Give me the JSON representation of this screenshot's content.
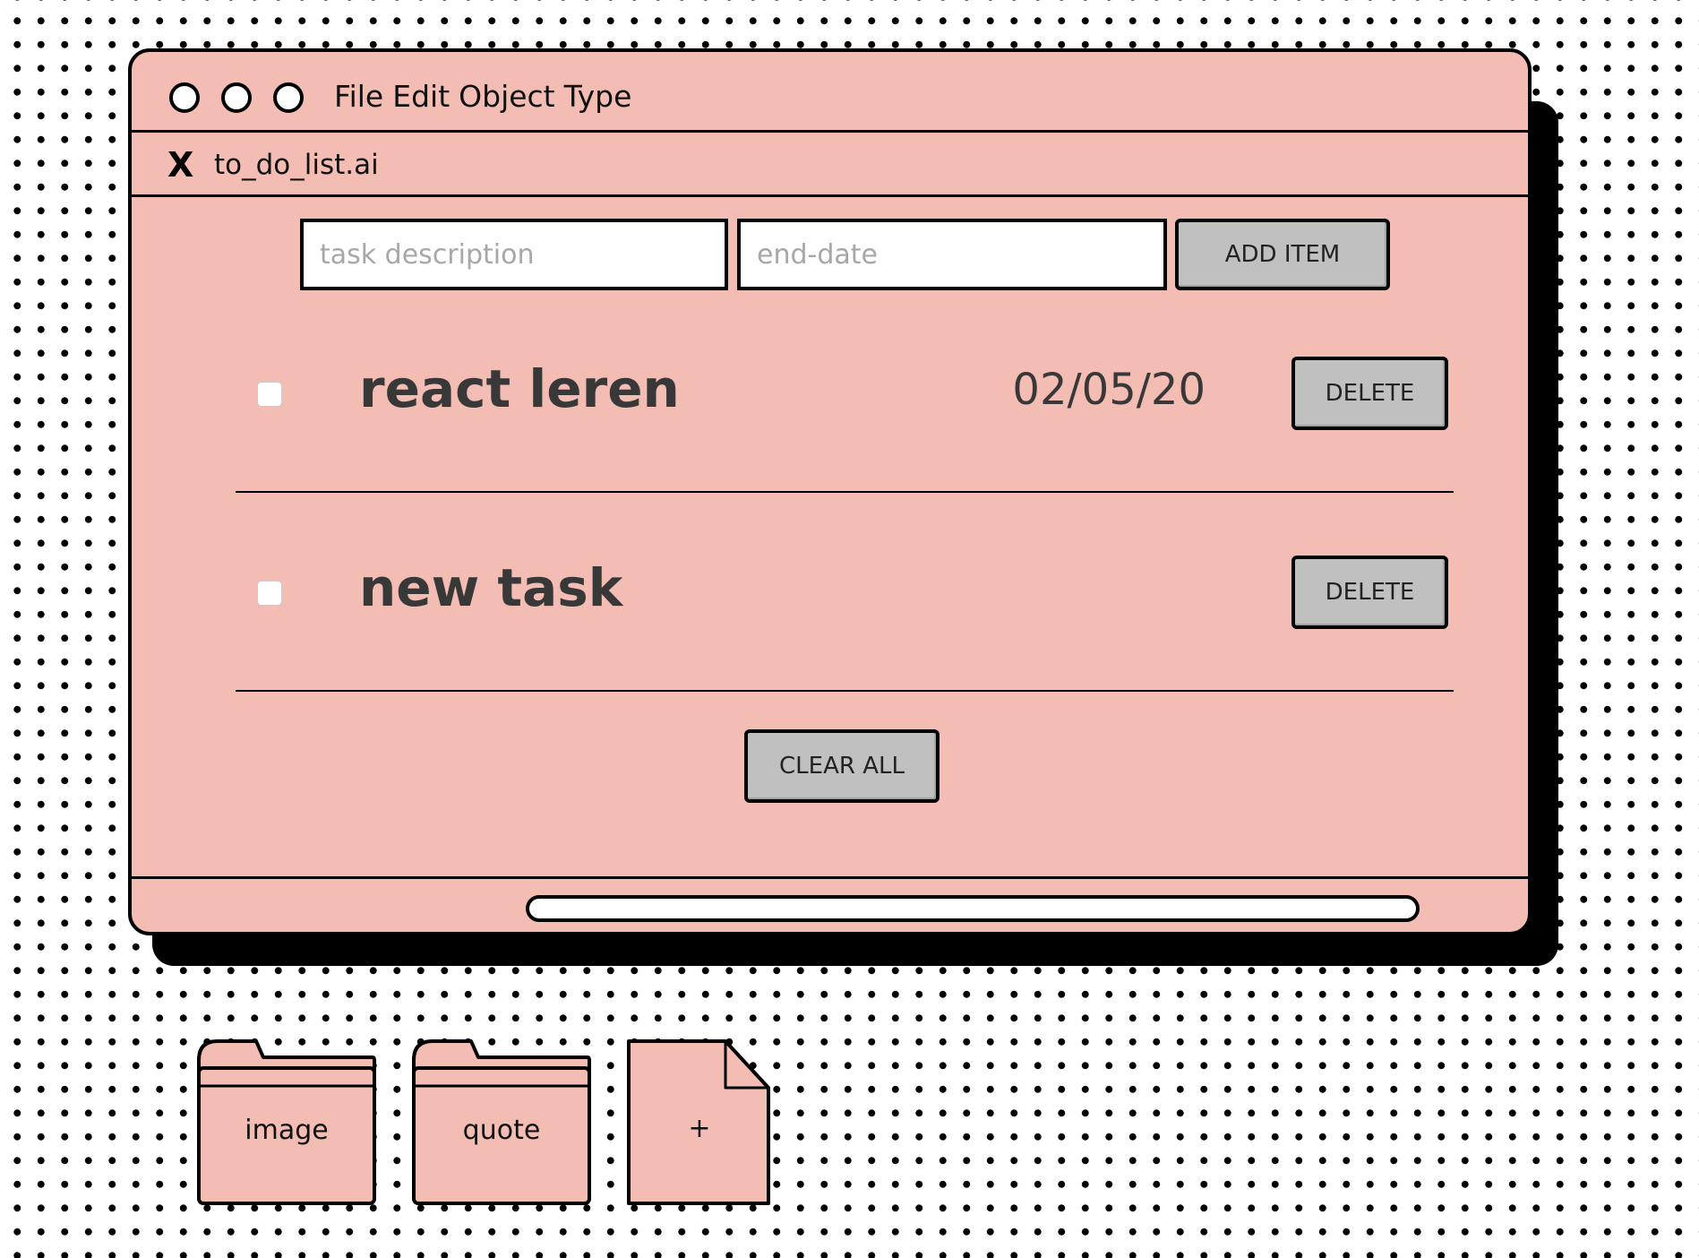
{
  "titlebar": {
    "menu": [
      "File",
      "Edit",
      "Object",
      "Type"
    ]
  },
  "tab": {
    "close_label": "X",
    "title": "to_do_list.ai"
  },
  "add_form": {
    "task_placeholder": "task description",
    "date_placeholder": "end-date",
    "add_label": "ADD ITEM"
  },
  "tasks": [
    {
      "text": "react leren",
      "date": "02/05/20",
      "checked": false,
      "delete_label": "DELETE"
    },
    {
      "text": "new task",
      "date": "",
      "checked": false,
      "delete_label": "DELETE"
    }
  ],
  "clear_label": "CLEAR ALL",
  "desktop": [
    {
      "label": "image",
      "icon": "folder-icon"
    },
    {
      "label": "quote",
      "icon": "folder-icon"
    },
    {
      "label": "+",
      "icon": "new-file-icon"
    }
  ],
  "colors": {
    "window_bg": "#f4bdb4",
    "button_bg": "#c0c0c0",
    "outline": "#000000"
  }
}
